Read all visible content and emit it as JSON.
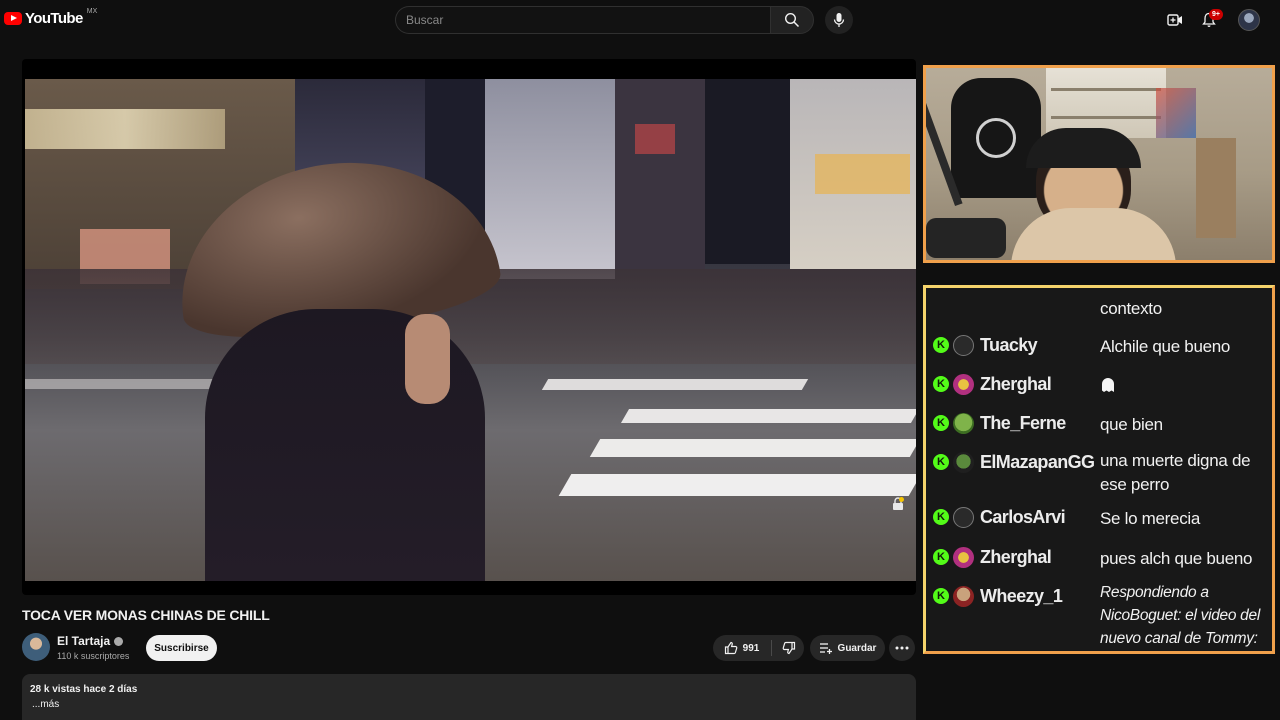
{
  "header": {
    "logo_text": "YouTube",
    "country_code": "MX",
    "search_placeholder": "Buscar",
    "notification_count": "9+"
  },
  "video": {
    "title": "TOCA VER MONAS CHINAS DE CHILL",
    "channel_name": "El Tartaja",
    "subscribers": "110 k suscriptores",
    "subscribe_label": "Suscribirse",
    "likes": "991",
    "save_label": "Guardar",
    "views_date": "28 k vistas  hace 2 días",
    "more_label": "...más"
  },
  "chat": {
    "cut_top_text": "contexto",
    "messages": [
      {
        "user": "Tuacky",
        "text": "Alchile que bueno"
      },
      {
        "user": "Zherghal",
        "text": ""
      },
      {
        "user": "The_Ferne",
        "text": "que bien"
      },
      {
        "user": "ElMazapanGG",
        "text": "una muerte digna de ese perro"
      },
      {
        "user": "CarlosArvi",
        "text": "Se lo merecia"
      },
      {
        "user": "Zherghal",
        "text": "pues alch que bueno"
      },
      {
        "user": "Wheezy_1",
        "text": "Respondiendo a NicoBoguet: el video del nuevo canal de Tommy:"
      }
    ],
    "badge_letter": "K"
  },
  "colors": {
    "accent_red": "#ff0000",
    "kick_green": "#53fc18",
    "overlay_orange": "#f0a04b",
    "overlay_yellow": "#f4d36b"
  }
}
